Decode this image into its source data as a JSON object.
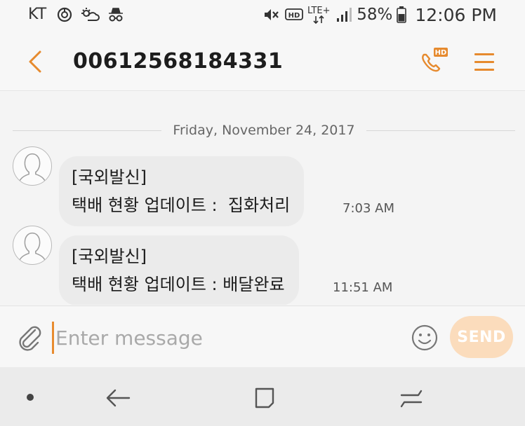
{
  "status_bar": {
    "carrier": "KT",
    "network": "LTE+",
    "battery": "58%",
    "time": "12:06 PM",
    "icons": [
      "sync-icon",
      "weather-icon",
      "incognito-icon",
      "mute-icon",
      "hd-voice-icon",
      "lte-icon",
      "signal-icon",
      "battery-icon"
    ]
  },
  "header": {
    "contact": "00612568184331",
    "hd_badge": "HD",
    "icons": [
      "back-arrow-icon",
      "hd-call-icon",
      "menu-icon"
    ]
  },
  "conversation": {
    "date": "Friday, November 24, 2017",
    "messages": [
      {
        "line1": "[국외발신]",
        "line2": "택배 현황 업데이트 :  집화처리",
        "time": "7:03 AM"
      },
      {
        "line1": "[국외발신]",
        "line2": "택배 현황 업데이트 : 배달완료",
        "time": "11:51 AM"
      }
    ]
  },
  "composer": {
    "placeholder": "Enter message",
    "value": "",
    "send_label": "SEND",
    "icons": [
      "attachment-icon",
      "emoji-icon"
    ]
  },
  "navbar": {
    "icons": [
      "dot-icon",
      "back-icon",
      "home-icon",
      "recent-apps-icon"
    ]
  },
  "colors": {
    "accent": "#e68a2e",
    "send_disabled": "#fbdcbc",
    "bubble": "#ebebeb"
  }
}
